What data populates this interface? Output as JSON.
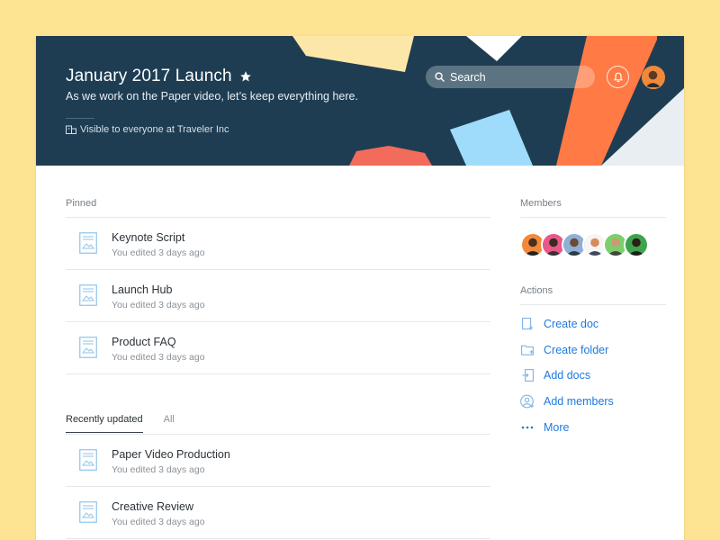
{
  "header": {
    "title": "January 2017 Launch",
    "subtitle": "As we work on the Paper video, let’s keep everything here.",
    "visibility": "Visible to everyone at Traveler Inc",
    "search_placeholder": "Search"
  },
  "pinned": {
    "label": "Pinned",
    "docs": [
      {
        "title": "Keynote Script",
        "meta": "You edited 3 days ago"
      },
      {
        "title": "Launch Hub",
        "meta": "You edited 3 days ago"
      },
      {
        "title": "Product FAQ",
        "meta": "You edited 3 days ago"
      }
    ]
  },
  "recent": {
    "tabs": [
      "Recently updated",
      "All"
    ],
    "docs": [
      {
        "title": "Paper Video Production",
        "meta": "You edited 3 days ago"
      },
      {
        "title": "Creative Review",
        "meta": "You edited 3 days ago"
      }
    ]
  },
  "sidebar": {
    "members_label": "Members",
    "actions_label": "Actions",
    "actions": [
      {
        "label": "Create doc",
        "icon": "new-doc-icon"
      },
      {
        "label": "Create folder",
        "icon": "new-folder-icon"
      },
      {
        "label": "Add docs",
        "icon": "add-docs-icon"
      },
      {
        "label": "Add members",
        "icon": "add-member-icon"
      },
      {
        "label": "More",
        "icon": "more-dots-icon"
      }
    ],
    "member_colors": [
      "#f08a3a",
      "#e8588a",
      "#8fb0d6",
      "#f5f5f5",
      "#7ccf6a",
      "#3fa34d"
    ]
  },
  "colors": {
    "background": "#fde493",
    "header": "#1e3d53",
    "accent_link": "#1f7ae0",
    "shape_orange": "#ff7a45",
    "shape_blue": "#9fdcfb",
    "shape_cream": "#fde7a8",
    "shape_red": "#f26b5b"
  }
}
